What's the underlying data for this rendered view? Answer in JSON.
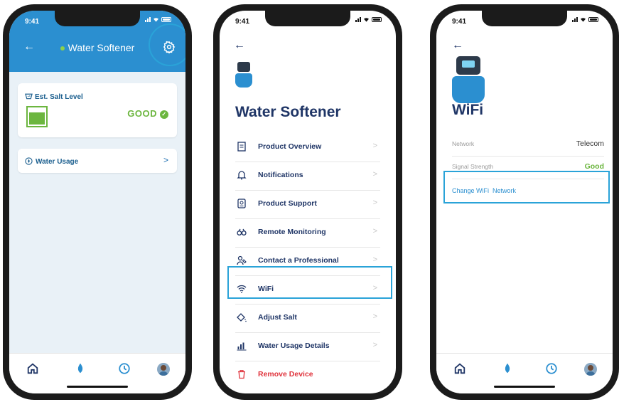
{
  "status_bar": {
    "time": "9:41"
  },
  "screen1": {
    "title": "Water Softener",
    "salt_label": "Est. Salt Level",
    "salt_status": "GOOD",
    "water_usage_label": "Water Usage"
  },
  "screen2": {
    "title": "Water Softener",
    "menu": [
      {
        "label": "Product Overview",
        "icon": "document-icon"
      },
      {
        "label": "Notifications",
        "icon": "bell-icon"
      },
      {
        "label": "Product Support",
        "icon": "support-icon"
      },
      {
        "label": "Remote Monitoring",
        "icon": "binoculars-icon"
      },
      {
        "label": "Contact a Professional",
        "icon": "professional-icon"
      },
      {
        "label": "WiFi",
        "icon": "wifi-icon"
      },
      {
        "label": "Adjust Salt",
        "icon": "salt-icon"
      },
      {
        "label": "Water Usage Details",
        "icon": "chart-icon"
      },
      {
        "label": "Remove Device",
        "icon": "trash-icon"
      }
    ]
  },
  "screen3": {
    "title": "WiFi",
    "network_label": "Network",
    "network_value": "Telecom",
    "signal_label": "Signal Strength",
    "signal_value": "Good",
    "change_label": "Change WiFi  Network"
  },
  "colors": {
    "header_blue": "#2b8fd0",
    "navy": "#1f3566",
    "good_green": "#6cb63f",
    "highlight": "#2aa3d8",
    "remove_red": "#e0333c"
  }
}
